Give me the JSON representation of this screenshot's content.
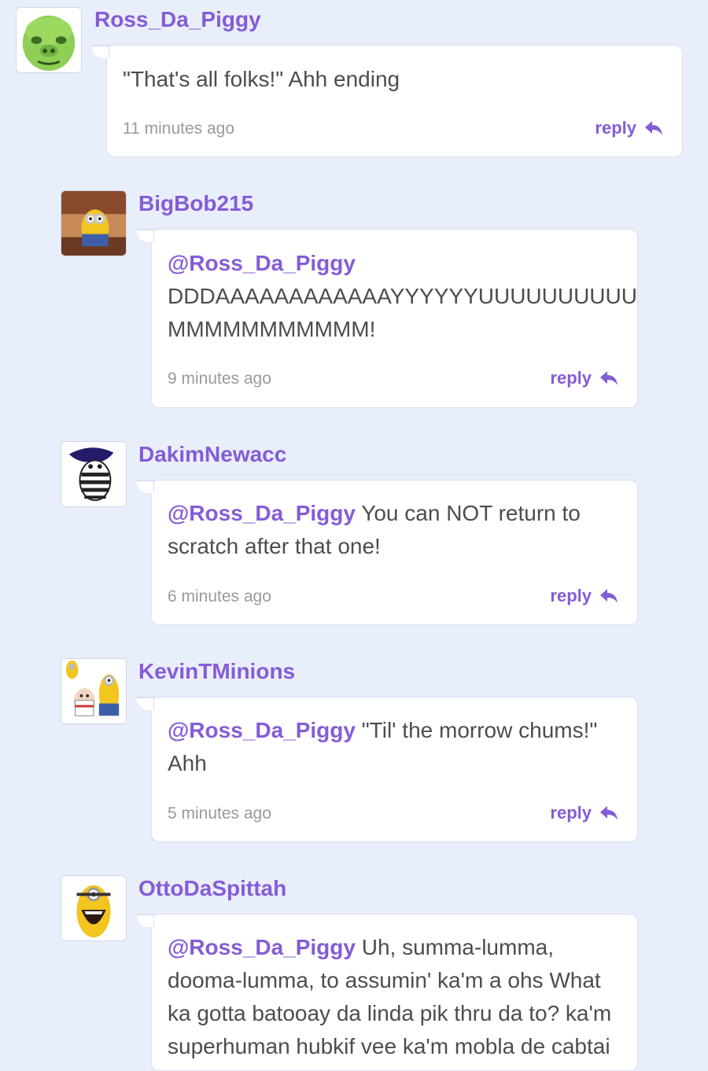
{
  "comments": [
    {
      "username": "Ross_Da_Piggy",
      "mention": "",
      "text": "\"That's all folks!\" Ahh ending",
      "time": "11 minutes ago",
      "reply_label": "reply",
      "avatar_icon": "green-pig-avatar"
    },
    {
      "username": "BigBob215",
      "mention": "@Ross_Da_Piggy",
      "text": "DDDAAAAAAAAAAAAYYYYYYUUUUUUUUUU MMMMMMMMMMM!",
      "time": "9 minutes ago",
      "reply_label": "reply",
      "avatar_icon": "minion-avatar"
    },
    {
      "username": "DakimNewacc",
      "mention": "@Ross_Da_Piggy",
      "text": "You can NOT return to scratch after that one!",
      "time": "6 minutes ago",
      "reply_label": "reply",
      "avatar_icon": "striped-character-avatar"
    },
    {
      "username": "KevinTMinions",
      "mention": "@Ross_Da_Piggy",
      "text": "\"Til' the morrow chums!\" Ahh",
      "time": "5 minutes ago",
      "reply_label": "reply",
      "avatar_icon": "minions-group-avatar"
    },
    {
      "username": "OttoDaSpittah",
      "mention": "@Ross_Da_Piggy",
      "text": "Uh, summa-lumma, dooma-lumma, to assumin' ka'm a ohs What ka gotta batooay da linda pik thru da to? ka'm superhuman hubkif vee ka'm mobla de cabtai",
      "time": "",
      "reply_label": "reply",
      "avatar_icon": "laughing-minion-avatar"
    }
  ],
  "colors": {
    "accent": "#855cd6",
    "background": "#e9eefb",
    "text": "#4d4d4d",
    "time": "#9a9a9a"
  }
}
